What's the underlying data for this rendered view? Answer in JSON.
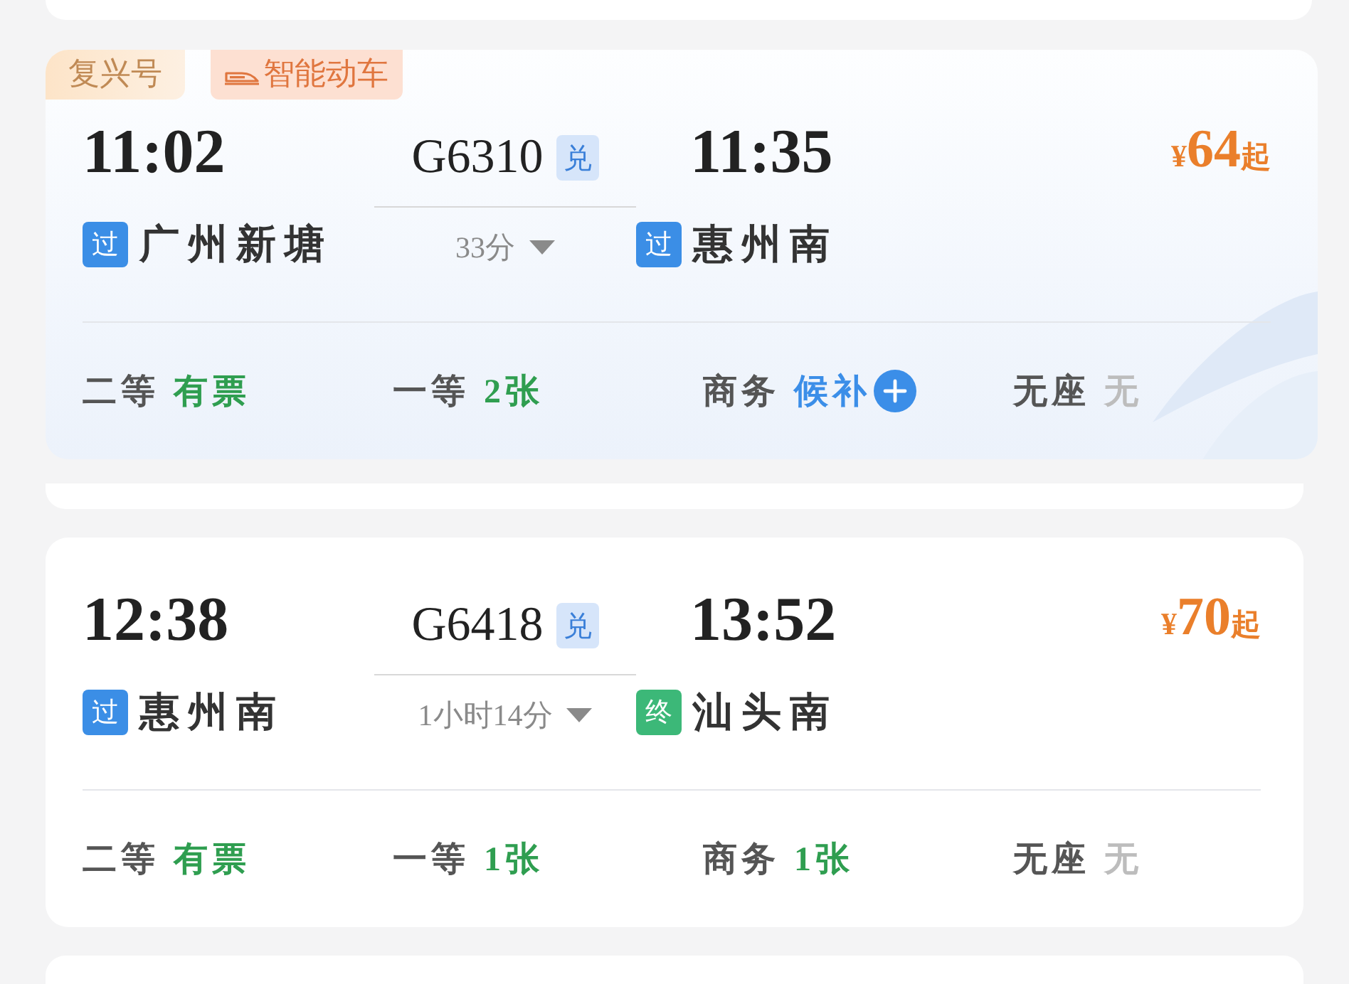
{
  "trains": [
    {
      "highlighted": true,
      "tags": [
        {
          "kind": "brand",
          "text": "复兴号"
        },
        {
          "kind": "smart",
          "text": "智能动车"
        }
      ],
      "departure": {
        "time": "11:02",
        "stop_tag": {
          "kind": "pass",
          "text": "过"
        },
        "station": "广州新塘"
      },
      "train_number": "G6310",
      "exchange_tag": "兑",
      "duration": "33分",
      "arrival": {
        "time": "11:35",
        "stop_tag": {
          "kind": "pass",
          "text": "过"
        },
        "station": "惠州南"
      },
      "price": {
        "currency": "¥",
        "amount": "64",
        "suffix": "起"
      },
      "seats": [
        {
          "class": "二等",
          "availability": "有票",
          "kind": "available"
        },
        {
          "class": "一等",
          "availability": "2张",
          "kind": "available"
        },
        {
          "class": "商务",
          "availability": "候补",
          "kind": "waitlist"
        },
        {
          "class": "无座",
          "availability": "无",
          "kind": "none"
        }
      ]
    },
    {
      "highlighted": false,
      "departure": {
        "time": "12:38",
        "stop_tag": {
          "kind": "pass",
          "text": "过"
        },
        "station": "惠州南"
      },
      "train_number": "G6418",
      "exchange_tag": "兑",
      "duration": "1小时14分",
      "arrival": {
        "time": "13:52",
        "stop_tag": {
          "kind": "terminal",
          "text": "终"
        },
        "station": "汕头南"
      },
      "price": {
        "currency": "¥",
        "amount": "70",
        "suffix": "起"
      },
      "seats": [
        {
          "class": "二等",
          "availability": "有票",
          "kind": "available"
        },
        {
          "class": "一等",
          "availability": "1张",
          "kind": "available"
        },
        {
          "class": "商务",
          "availability": "1张",
          "kind": "available"
        },
        {
          "class": "无座",
          "availability": "无",
          "kind": "none"
        }
      ]
    }
  ]
}
